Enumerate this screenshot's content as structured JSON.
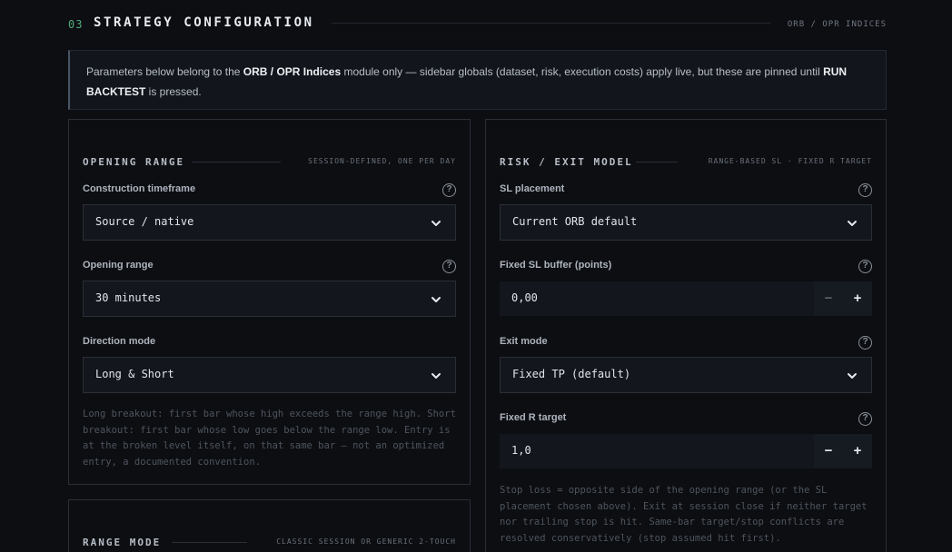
{
  "section": {
    "number": "03",
    "title": "STRATEGY CONFIGURATION",
    "tag": "ORB / OPR INDICES"
  },
  "info": {
    "part1": "Parameters below belong to the ",
    "module": "ORB / OPR Indices",
    "part2": " module only — sidebar globals (dataset, risk, execution costs) apply live, but these are pinned until ",
    "action": "RUN BACKTEST",
    "part3": " is pressed."
  },
  "opening_range": {
    "title": "OPENING RANGE",
    "tag": "SESSION-DEFINED, ONE PER DAY",
    "fields": {
      "construction": {
        "label": "Construction timeframe",
        "value": "Source / native"
      },
      "range": {
        "label": "Opening range",
        "value": "30 minutes"
      },
      "direction": {
        "label": "Direction mode",
        "value": "Long & Short"
      }
    },
    "note": "Long breakout: first bar whose high exceeds the range high. Short breakout: first bar whose low goes below the range low. Entry is at the broken level itself, on that same bar — not an optimized entry, a documented convention."
  },
  "risk_exit": {
    "title": "RISK / EXIT MODEL",
    "tag": "RANGE-BASED SL · FIXED R TARGET",
    "fields": {
      "sl_placement": {
        "label": "SL placement",
        "value": "Current ORB default"
      },
      "sl_buffer": {
        "label": "Fixed SL buffer (points)",
        "value": "0,00"
      },
      "exit_mode": {
        "label": "Exit mode",
        "value": "Fixed TP (default)"
      },
      "r_target": {
        "label": "Fixed R target",
        "value": "1,0"
      }
    },
    "note": "Stop loss = opposite side of the opening range (or the SL placement chosen above). Exit at session close if neither target nor trailing stop is hit. Same-bar target/stop conflicts are resolved conservatively (stop assumed hit first)."
  },
  "range_mode": {
    "title": "RANGE MODE",
    "tag": "CLASSIC SESSION OR GENERIC 2-TOUCH"
  },
  "controls": {
    "help": "?",
    "minus": "−",
    "plus": "+"
  }
}
